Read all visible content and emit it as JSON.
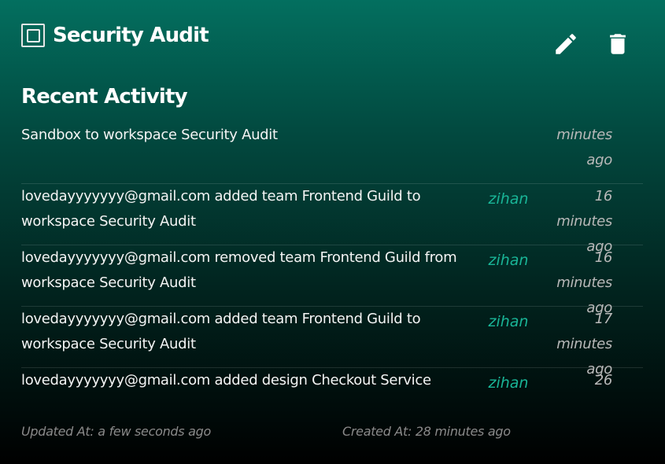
{
  "card": {
    "title": "Security Audit",
    "actions": {
      "edit_icon": "pencil-icon",
      "delete_icon": "trash-icon"
    }
  },
  "recent_activity": {
    "heading": "Recent Activity",
    "items": [
      {
        "message": "Sandbox to workspace Security Audit",
        "user": "",
        "time_line1": "minutes",
        "time_line2": "ago"
      },
      {
        "message": "lovedayyyyyyy@gmail.com added team Frontend Guild to workspace Security Audit",
        "user": "zihan",
        "time_line1": "16 minutes",
        "time_line2": "ago"
      },
      {
        "message": "lovedayyyyyyy@gmail.com removed team Frontend Guild from workspace Security Audit",
        "user": "zihan",
        "time_line1": "16 minutes",
        "time_line2": "ago"
      },
      {
        "message": "lovedayyyyyyy@gmail.com added team Frontend Guild to workspace Security Audit",
        "user": "zihan",
        "time_line1": "17 minutes",
        "time_line2": "ago"
      },
      {
        "message": "lovedayyyyyyy@gmail.com added design Checkout Service",
        "user": "zihan",
        "time_line1": "26",
        "time_line2": ""
      }
    ]
  },
  "footer": {
    "updated_at": "Updated At: a few seconds ago",
    "created_at": "Created At: 28 minutes ago"
  },
  "colors": {
    "accent": "#19b597",
    "gradient_top": "#036f5f",
    "gradient_bottom": "#000000"
  }
}
